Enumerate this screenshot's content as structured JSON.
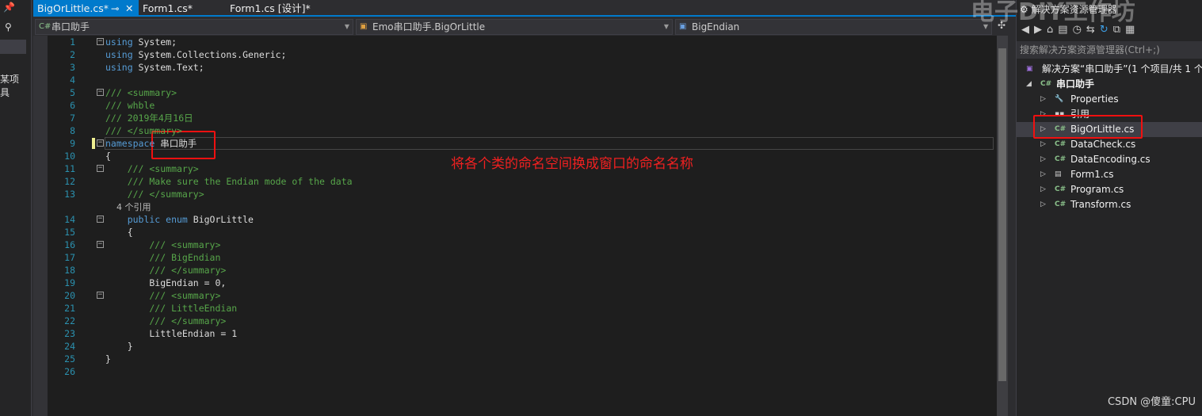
{
  "left_panel": {
    "items": [
      "某项",
      "具"
    ]
  },
  "tabs": [
    {
      "label": "BigOrLittle.cs*",
      "active": true
    },
    {
      "label": "Form1.cs*"
    },
    {
      "label": "Form1.cs [设计]*"
    }
  ],
  "navbar": {
    "project": "串口助手",
    "class": "Emo串口助手.BigOrLittle",
    "member": "BigEndian"
  },
  "code_lines": [
    {
      "n": "1",
      "fold": true,
      "seg": [
        [
          "using ",
          "kw"
        ],
        [
          "System;",
          "tx"
        ]
      ]
    },
    {
      "n": "2",
      "seg": [
        [
          "using ",
          "kw"
        ],
        [
          "System.Collections.Generic;",
          "tx"
        ]
      ]
    },
    {
      "n": "3",
      "seg": [
        [
          "using ",
          "kw"
        ],
        [
          "System.Text;",
          "tx"
        ]
      ]
    },
    {
      "n": "4",
      "seg": []
    },
    {
      "n": "5",
      "fold": true,
      "seg": [
        [
          "/// <summary>",
          "cm"
        ]
      ]
    },
    {
      "n": "6",
      "seg": [
        [
          "/// whble",
          "cm"
        ]
      ]
    },
    {
      "n": "7",
      "seg": [
        [
          "/// 2019年4月16日",
          "cm"
        ]
      ]
    },
    {
      "n": "8",
      "seg": [
        [
          "/// </summary>",
          "cm"
        ]
      ]
    },
    {
      "n": "9",
      "fold": true,
      "seg": [
        [
          "namespace ",
          "kw"
        ],
        [
          "串口助手",
          "tx"
        ]
      ]
    },
    {
      "n": "10",
      "seg": [
        [
          "{",
          "tx"
        ]
      ]
    },
    {
      "n": "11",
      "fold": true,
      "seg": [
        [
          "    /// <summary>",
          "cm"
        ]
      ]
    },
    {
      "n": "12",
      "seg": [
        [
          "    /// Make sure the Endian mode of the data",
          "cm"
        ]
      ]
    },
    {
      "n": "13",
      "seg": [
        [
          "    /// </summary>",
          "cm"
        ]
      ]
    },
    {
      "n": "",
      "seg": [
        [
          "    4 个引用",
          "ref"
        ]
      ]
    },
    {
      "n": "14",
      "fold": true,
      "seg": [
        [
          "    public enum ",
          "kw"
        ],
        [
          "BigOrLittle",
          "tx"
        ]
      ]
    },
    {
      "n": "15",
      "seg": [
        [
          "    {",
          "tx"
        ]
      ]
    },
    {
      "n": "16",
      "fold": true,
      "seg": [
        [
          "        /// <summary>",
          "cm"
        ]
      ]
    },
    {
      "n": "17",
      "seg": [
        [
          "        /// BigEndian",
          "cm"
        ]
      ]
    },
    {
      "n": "18",
      "seg": [
        [
          "        /// </summary>",
          "cm"
        ]
      ]
    },
    {
      "n": "19",
      "seg": [
        [
          "        BigEndian = 0,",
          "tx"
        ]
      ]
    },
    {
      "n": "20",
      "fold": true,
      "seg": [
        [
          "        /// <summary>",
          "cm"
        ]
      ]
    },
    {
      "n": "21",
      "seg": [
        [
          "        /// LittleEndian",
          "cm"
        ]
      ]
    },
    {
      "n": "22",
      "seg": [
        [
          "        /// </summary>",
          "cm"
        ]
      ]
    },
    {
      "n": "23",
      "seg": [
        [
          "        LittleEndian = 1",
          "tx"
        ]
      ]
    },
    {
      "n": "24",
      "seg": [
        [
          "    }",
          "tx"
        ]
      ]
    },
    {
      "n": "25",
      "seg": [
        [
          "}",
          "tx"
        ]
      ]
    },
    {
      "n": "26",
      "seg": []
    }
  ],
  "annotation": "将各个类的命名空间换成窗口的命名名称",
  "solution_explorer": {
    "title": "解决方案资源管理器",
    "search_placeholder": "搜索解决方案资源管理器(Ctrl+;)",
    "nodes": [
      {
        "label": "解决方案“串口助手”(1 个项目/共 1 个",
        "level": 0,
        "icon": "solution-icon"
      },
      {
        "label": "串口助手",
        "level": 1,
        "icon": "csharp-project-icon",
        "expanded": true
      },
      {
        "label": "Properties",
        "level": 2,
        "icon": "wrench-icon"
      },
      {
        "label": "引用",
        "level": 2,
        "icon": "references-icon"
      },
      {
        "label": "BigOrLittle.cs",
        "level": 2,
        "icon": "csharp-file-icon",
        "selected": true
      },
      {
        "label": "DataCheck.cs",
        "level": 2,
        "icon": "csharp-file-icon"
      },
      {
        "label": "DataEncoding.cs",
        "level": 2,
        "icon": "csharp-file-icon"
      },
      {
        "label": "Form1.cs",
        "level": 2,
        "icon": "form-icon"
      },
      {
        "label": "Program.cs",
        "level": 2,
        "icon": "csharp-file-icon"
      },
      {
        "label": "Transform.cs",
        "level": 2,
        "icon": "csharp-file-icon"
      }
    ]
  },
  "watermarks": {
    "top": "电子DIY工作坊",
    "bottom": "CSDN @傻童:CPU"
  },
  "colors": {
    "accent": "#007acc",
    "keyword": "#569cd6",
    "comment": "#57a64a",
    "line_number": "#2b91af",
    "highlight": "#f01010"
  }
}
